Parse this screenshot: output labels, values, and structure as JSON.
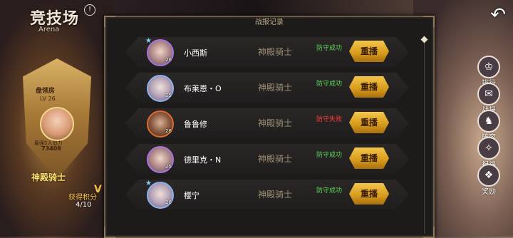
{
  "arena": {
    "title": "竞技场",
    "subtitle": "Arena",
    "info_icon": "!",
    "crest": {
      "rank_title": "盘领房",
      "level": "LV 26",
      "power_label": "最强5人战力",
      "power_value": "73408",
      "rank_name": "神殿骑士"
    },
    "points_label": "获得积分",
    "points_value": "4/10",
    "points_v": "V"
  },
  "panel": {
    "title": "战报记录",
    "rows": [
      {
        "name": "小西斯",
        "level": "26",
        "rank": "神殿骑士",
        "result": "防守成功",
        "result_type": "win",
        "replay": "重播",
        "avatar": "violet"
      },
      {
        "name": "布莱恩・O",
        "level": "25",
        "rank": "神殿骑士",
        "result": "防守成功",
        "result_type": "win",
        "replay": "重播",
        "avatar": "blue"
      },
      {
        "name": "鲁鲁修",
        "level": "26",
        "rank": "神殿骑士",
        "result": "防守失败",
        "result_type": "lose",
        "replay": "重播",
        "avatar": "red"
      },
      {
        "name": "德里克・N",
        "level": "25",
        "rank": "神殿骑士",
        "result": "防守成功",
        "result_type": "win",
        "replay": "重播",
        "avatar": "violet"
      },
      {
        "name": "樱宁",
        "level": "26",
        "rank": "神殿骑士",
        "result": "防守成功",
        "result_type": "win",
        "replay": "重播",
        "avatar": "blue"
      }
    ]
  },
  "side_menu": [
    {
      "label": "排行",
      "icon": "ranking-icon",
      "glyph": "♔"
    },
    {
      "label": "战报",
      "icon": "battle-report-icon",
      "glyph": "✉"
    },
    {
      "label": "阵容",
      "icon": "lineup-icon",
      "glyph": "♞"
    },
    {
      "label": "祝福",
      "icon": "blessing-icon",
      "glyph": "✧"
    },
    {
      "label": "奖励",
      "icon": "reward-icon",
      "glyph": "❖"
    }
  ],
  "back_glyph": "↶"
}
